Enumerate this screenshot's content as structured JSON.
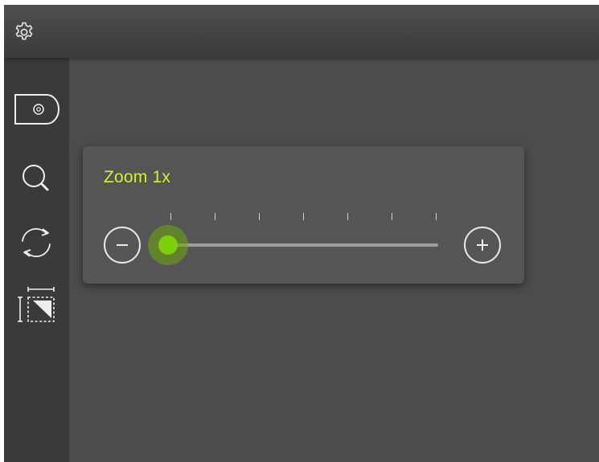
{
  "colors": {
    "accent_label": "#d8ee2e",
    "slider_thumb": "#7ccf0a",
    "panel_bg": "#555555",
    "canvas_bg": "#4c4c4c",
    "sidebar_bg": "#3a3a3a"
  },
  "topbar": {
    "settings_icon": "gear-icon"
  },
  "sidebar": {
    "items": [
      {
        "id": "camera",
        "icon": "camera-icon"
      },
      {
        "id": "zoom",
        "icon": "magnifier-icon"
      },
      {
        "id": "rotate",
        "icon": "rotate-icon"
      },
      {
        "id": "crop",
        "icon": "crop-icon"
      }
    ]
  },
  "zoom_panel": {
    "label": "Zoom 1x",
    "minus_icon": "minus-icon",
    "plus_icon": "plus-icon",
    "slider": {
      "tick_count": 7,
      "level": 0.0
    }
  }
}
